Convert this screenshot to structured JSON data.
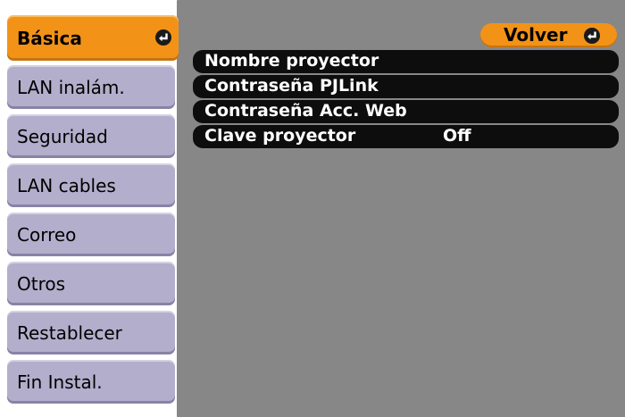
{
  "sidebar": {
    "items": [
      {
        "label": "Básica",
        "active": true
      },
      {
        "label": "LAN inalám."
      },
      {
        "label": "Seguridad"
      },
      {
        "label": "LAN cables"
      },
      {
        "label": "Correo"
      },
      {
        "label": "Otros"
      },
      {
        "label": "Restablecer"
      },
      {
        "label": "Fin Instal."
      }
    ]
  },
  "panel": {
    "back_label": "Volver",
    "rows": [
      {
        "label": "Nombre proyector",
        "value": ""
      },
      {
        "label": "Contraseña PJLink",
        "value": ""
      },
      {
        "label": "Contraseña Acc. Web",
        "value": ""
      },
      {
        "label": "Clave proyector",
        "value": "Off"
      }
    ]
  },
  "colors": {
    "accent": "#f29318",
    "sidebar_item": "#b2aecb",
    "panel_bg": "#878787",
    "row_bg": "#0d0d0d"
  },
  "icons": {
    "active_item_icon": "enter-icon",
    "back_icon": "enter-icon"
  }
}
